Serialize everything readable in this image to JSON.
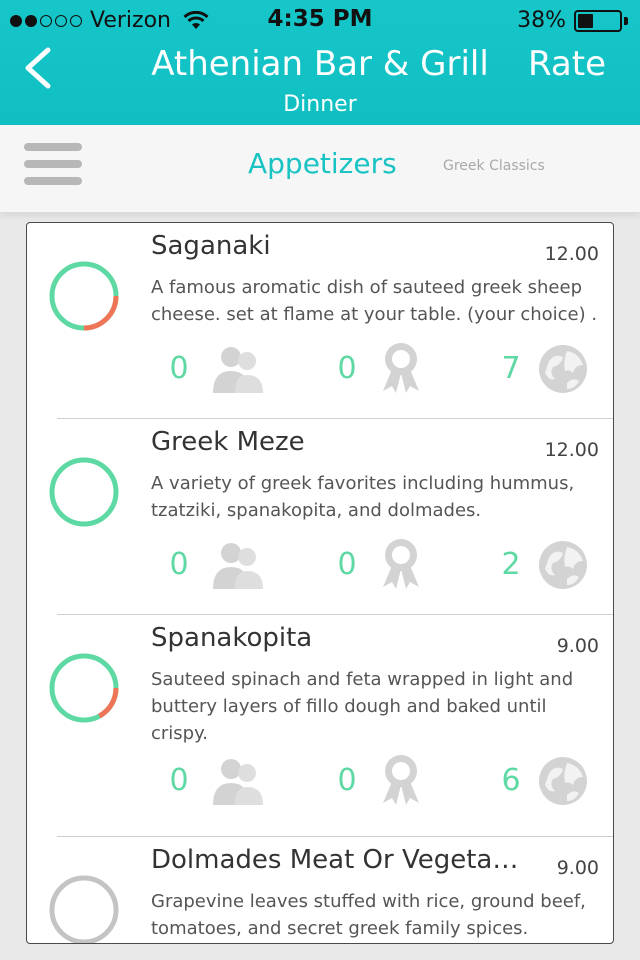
{
  "status": {
    "carrier": "Verizon",
    "time": "4:35 PM",
    "battery": "38%",
    "battery_level": 0.38
  },
  "nav": {
    "back_icon": "chevron-left-icon",
    "title": "Athenian Bar & Grill",
    "subtitle": "Dinner",
    "rate_label": "Rate"
  },
  "categories": {
    "active": "Appetizers",
    "next": "Greek Classics"
  },
  "colors": {
    "accent": "#16c6c9",
    "count_green": "#5ed9a3",
    "ring_green": "#5ed9a3",
    "ring_red": "#f07458",
    "ring_gray": "#c4c4c4"
  },
  "items": [
    {
      "name": "Saganaki",
      "price": "12.00",
      "desc": "A famous aromatic dish of sauteed greek sheep cheese. set at flame at your table. (your choice) .",
      "friends": "0",
      "awards": "0",
      "global": "7",
      "red_fraction": 0.25
    },
    {
      "name": "Greek Meze",
      "price": "12.00",
      "desc": "A variety of greek favorites including hummus, tzatziki, spanakopita, and dolmades.",
      "friends": "0",
      "awards": "0",
      "global": "2",
      "red_fraction": 0
    },
    {
      "name": "Spanakopita",
      "price": "9.00",
      "desc": "Sauteed spinach and feta wrapped in light and buttery layers of fillo dough and baked until crispy.",
      "friends": "0",
      "awards": "0",
      "global": "6",
      "red_fraction": 0.17
    },
    {
      "name": "Dolmades Meat Or Vegeta…",
      "price": "9.00",
      "desc": "Grapevine leaves stuffed with rice, ground beef, tomatoes, and secret greek family spices.",
      "friends": "",
      "awards": "",
      "global": "",
      "red_fraction": 0
    }
  ]
}
